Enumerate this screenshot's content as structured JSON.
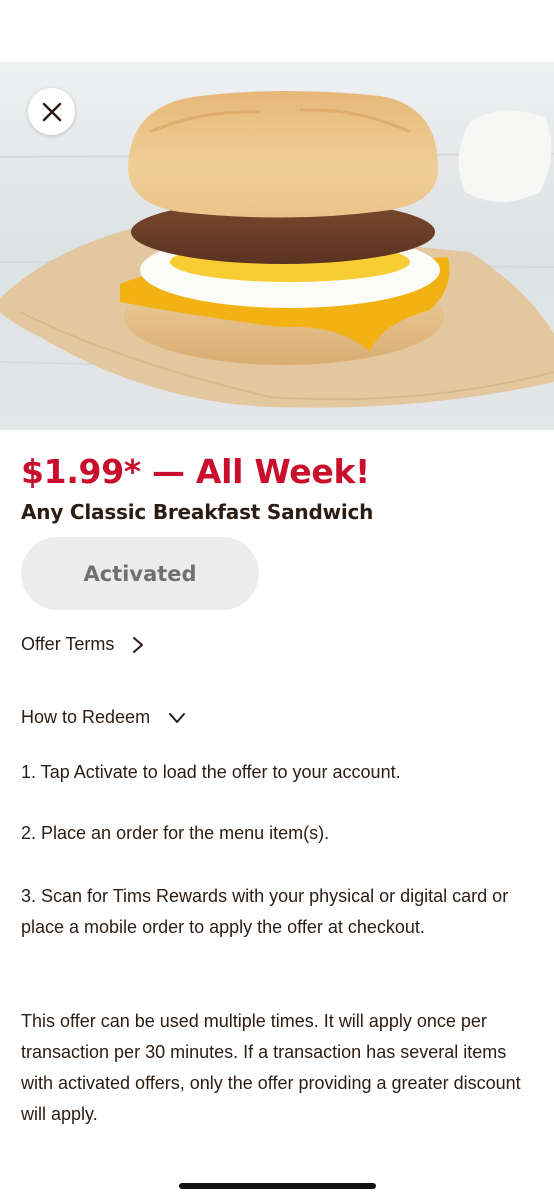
{
  "offer": {
    "headline": "$1.99* — All Week!",
    "item_name": "Any Classic Breakfast Sandwich",
    "activated_label": "Activated"
  },
  "links": {
    "offer_terms": "Offer Terms",
    "how_to_redeem": "How to Redeem"
  },
  "redeem_steps": [
    "1. Tap Activate to load the offer to your account.",
    "2. Place an order for the menu item(s).",
    "3. Scan for Tims Rewards with your physical or digital card or place a mobile order to apply the offer at checkout."
  ],
  "disclaimer": "This offer can be used multiple times. It will apply once per transaction per 30 minutes. If a transaction has several items with activated offers, only the offer providing a greater discount will apply.",
  "icons": {
    "close": "close-icon",
    "offer_terms": "chevron-right-icon",
    "how_to_redeem": "chevron-down-icon"
  },
  "colors": {
    "brand_red": "#c8102e",
    "text_dark": "#2b1d14",
    "button_gray": "#ececec",
    "button_text": "#707070"
  }
}
